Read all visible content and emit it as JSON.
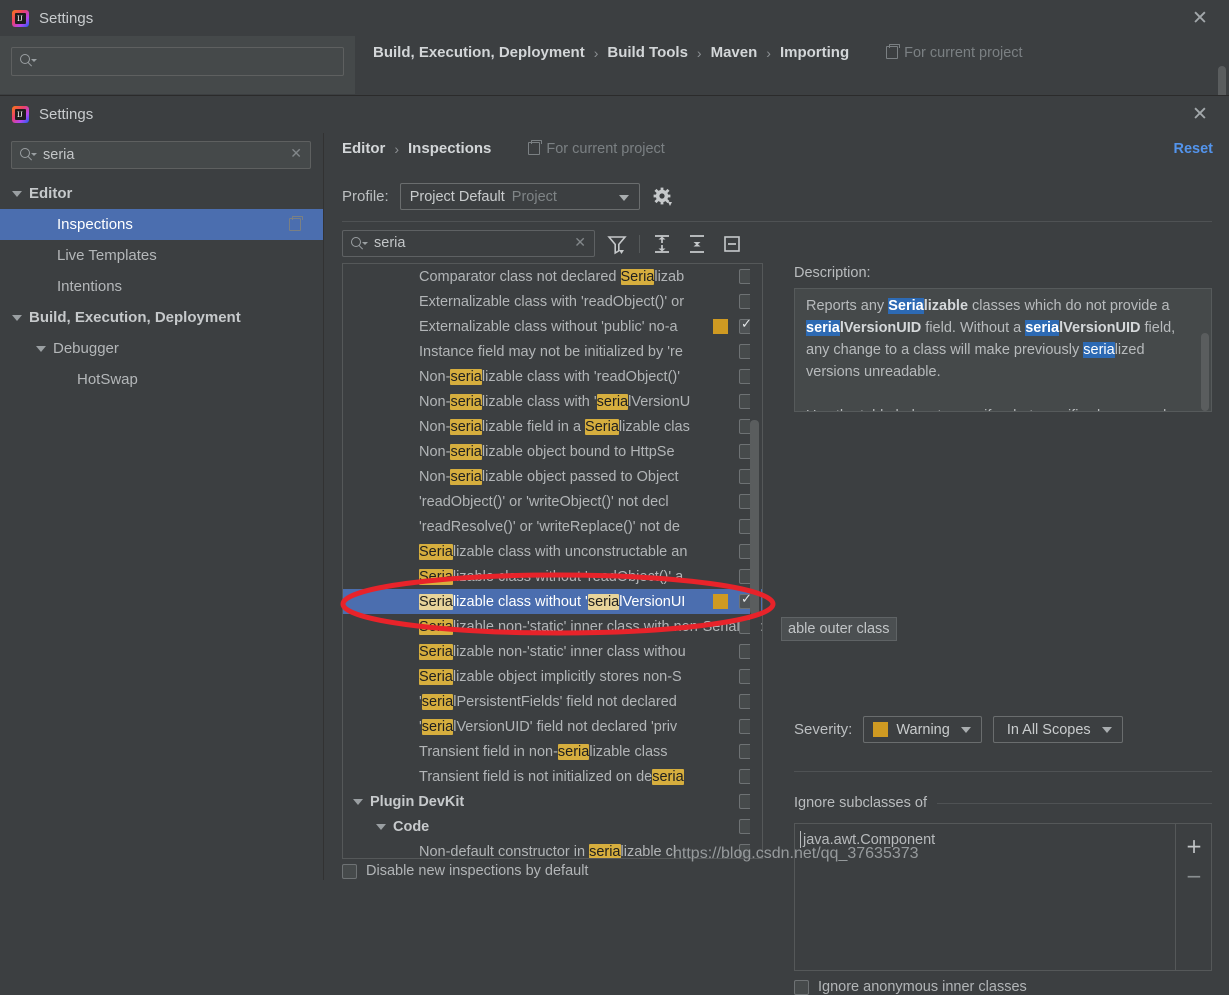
{
  "background_window": {
    "title": "Settings",
    "icon": "intellij-idea-logo",
    "search_placeholder": "",
    "search_value": "",
    "breadcrumb": [
      "Build, Execution, Deployment",
      "Build Tools",
      "Maven",
      "Importing"
    ],
    "scope_label": "For current project",
    "close_label": "✕"
  },
  "dialog": {
    "title": "Settings",
    "close_label": "✕",
    "search_value": "seria",
    "search_clear": "✕",
    "breadcrumb": [
      "Editor",
      "Inspections"
    ],
    "scope_label": "For current project",
    "reset_label": "Reset",
    "sidebar": [
      {
        "label": "Editor",
        "level": 0,
        "bold": true,
        "expandable": true,
        "selected": false,
        "badge": false
      },
      {
        "label": "Inspections",
        "level": 1,
        "bold": false,
        "expandable": false,
        "selected": true,
        "badge": true
      },
      {
        "label": "Live Templates",
        "level": 1,
        "bold": false,
        "expandable": false,
        "selected": false,
        "badge": false
      },
      {
        "label": "Intentions",
        "level": 1,
        "bold": false,
        "expandable": false,
        "selected": false,
        "badge": false
      },
      {
        "label": "Build, Execution, Deployment",
        "level": 0,
        "bold": true,
        "expandable": true,
        "selected": false,
        "badge": false
      },
      {
        "label": "Debugger",
        "level": 1,
        "bold": false,
        "expandable": true,
        "selected": false,
        "badge": false
      },
      {
        "label": "HotSwap",
        "level": 2,
        "bold": false,
        "expandable": false,
        "selected": false,
        "badge": false
      }
    ],
    "profile": {
      "label": "Profile:",
      "value": "Project Default",
      "scope": "Project",
      "gear_icon": "gear-icon"
    },
    "filter": {
      "value": "seria",
      "clear": "✕",
      "buttons": [
        "filter-icon",
        "expand-all-icon",
        "collapse-all-icon",
        "group-by-severity-icon"
      ]
    },
    "inspections": [
      {
        "text": "Comparator class not declared ",
        "hl": "Seria",
        "tail": "lizab",
        "indent": true,
        "checked": false,
        "severity": false
      },
      {
        "text": "Externalizable class with 'readObject()' or",
        "hl": "",
        "tail": "",
        "indent": true,
        "checked": false,
        "severity": false
      },
      {
        "text": "Externalizable class without 'public' no-a",
        "hl": "",
        "tail": "",
        "indent": true,
        "checked": true,
        "severity": true
      },
      {
        "text": "Instance field may not be initialized by 're",
        "hl": "",
        "tail": "",
        "indent": true,
        "checked": false,
        "severity": false
      },
      {
        "text": "Non-",
        "hl": "seria",
        "tail": "lizable class with 'readObject()'",
        "indent": true,
        "checked": false,
        "severity": false
      },
      {
        "text": "Non-",
        "hl": "seria",
        "tail": "lizable class with '",
        "hl2": "seria",
        "tail2": "lVersionU",
        "indent": true,
        "checked": false,
        "severity": false
      },
      {
        "text": "Non-",
        "hl": "seria",
        "tail": "lizable field in a ",
        "hl2": "Seria",
        "tail2": "lizable clas",
        "indent": true,
        "checked": false,
        "severity": false
      },
      {
        "text": "Non-",
        "hl": "seria",
        "tail": "lizable object bound to HttpSe",
        "indent": true,
        "checked": false,
        "severity": false
      },
      {
        "text": "Non-",
        "hl": "seria",
        "tail": "lizable object passed to Object",
        "indent": true,
        "checked": false,
        "severity": false
      },
      {
        "text": "'readObject()' or 'writeObject()' not decl",
        "hl": "",
        "tail": "",
        "indent": true,
        "checked": false,
        "severity": false
      },
      {
        "text": "'readResolve()' or 'writeReplace()' not de",
        "hl": "",
        "tail": "",
        "indent": true,
        "checked": false,
        "severity": false
      },
      {
        "text": "",
        "hl": "Seria",
        "tail": "lizable class with unconstructable an",
        "indent": true,
        "checked": false,
        "severity": false
      },
      {
        "text": "",
        "hl": "Seria",
        "tail": "lizable class without 'readObject()' a",
        "indent": true,
        "checked": false,
        "severity": false
      },
      {
        "text": "",
        "hl": "Seria",
        "tail": "lizable class without '",
        "hl2": "seria",
        "tail2": "lVersionUI",
        "indent": true,
        "checked": true,
        "severity": true,
        "selected": true
      },
      {
        "text": "",
        "hl": "Seria",
        "tail": "lizable non-'static' inner class with non-Serializable outer class",
        "indent": true,
        "checked": false,
        "severity": false
      },
      {
        "text": "",
        "hl": "Seria",
        "tail": "lizable non-'static' inner class withou",
        "indent": true,
        "checked": false,
        "severity": false
      },
      {
        "text": "",
        "hl": "Seria",
        "tail": "lizable object implicitly stores non-S",
        "indent": true,
        "checked": false,
        "severity": false
      },
      {
        "text": "'",
        "hl": "seria",
        "tail": "lPersistentFields' field not declared",
        "indent": true,
        "checked": false,
        "severity": false
      },
      {
        "text": "'",
        "hl": "seria",
        "tail": "lVersionUID' field not declared 'priv",
        "indent": true,
        "checked": false,
        "severity": false
      },
      {
        "text": "Transient field in non-",
        "hl": "seria",
        "tail": "lizable class",
        "indent": true,
        "checked": false,
        "severity": false
      },
      {
        "text": "Transient field is not initialized on de",
        "hl": "seria",
        "tail": "",
        "indent": true,
        "checked": false,
        "severity": false
      },
      {
        "text": "Plugin DevKit",
        "hl": "",
        "tail": "",
        "group": 1,
        "checked": false,
        "severity": false
      },
      {
        "text": "Code",
        "hl": "",
        "tail": "",
        "group": 2,
        "checked": false,
        "severity": false
      },
      {
        "text": "Non-default constructor in ",
        "hl": "seria",
        "tail": "lizable cl",
        "indent": true,
        "checked": false,
        "severity": false
      }
    ],
    "row_tooltip": "able outer class",
    "bottom_checkbox": "Disable new inspections by default",
    "description": {
      "label": "Description:",
      "paragraph_1": "Reports any Serializable classes which do not provide a serialVersionUID field. Without a serialVersionUID field, any change to a class will make previously serialized versions unreadable.",
      "paragraph_2": "Use the table below to specify what specific classes and inheritors should be excluded from being checked by this inspection. This is meant for those classes which, although they inherit Serializable from a superclass, are not intended for serialization. Such classes would lead this inspection to report unnecessarily."
    },
    "severity": {
      "label": "Severity:",
      "value": "Warning",
      "color": "#cf9a22",
      "scope_value": "In All Scopes"
    },
    "options": {
      "ignore_subclasses_label": "Ignore subclasses of",
      "ignore_items": [
        "java.awt.Component"
      ],
      "add_label": "+",
      "remove_label": "−",
      "ignore_anonymous_label": "Ignore anonymous inner classes",
      "ignore_anonymous_checked": false
    }
  },
  "watermark": "https://blog.csdn.net/qq_37635373",
  "colors": {
    "window_bg": "#3c3f41",
    "selection_blue": "#4b6eaf",
    "highlight_gold": "#d6ae3e",
    "highlight_blue": "#2d6ab4",
    "link_blue": "#5394ec",
    "warning_swatch": "#cf9a22",
    "annotation_red": "#e8232a"
  }
}
